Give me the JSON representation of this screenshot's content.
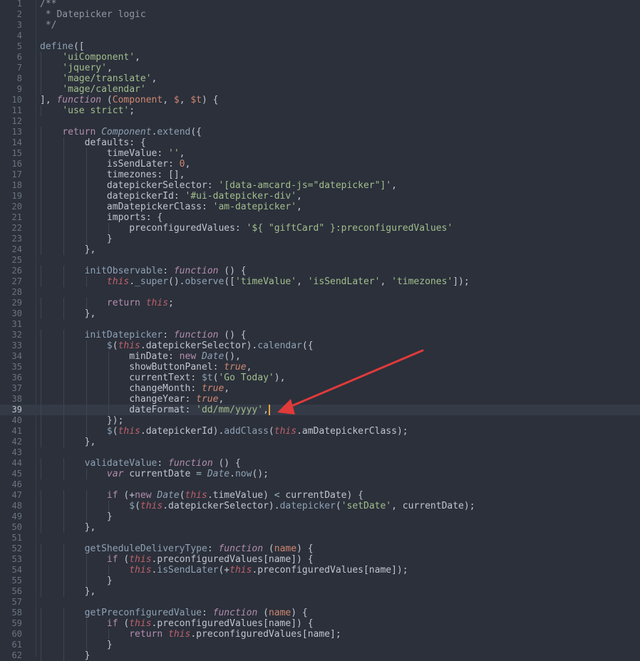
{
  "editor": {
    "current_line": 39,
    "cursor": {
      "line": 39
    },
    "lines": [
      [
        [
          "/**",
          "comment"
        ]
      ],
      [
        [
          " * Datepicker logic",
          "comment"
        ]
      ],
      [
        [
          " */",
          "comment"
        ]
      ],
      [],
      [
        [
          "define",
          "func"
        ],
        [
          "([",
          "punct"
        ]
      ],
      [
        [
          "    ",
          "plain"
        ],
        [
          "'uiComponent'",
          "string"
        ],
        [
          ",",
          "punct"
        ]
      ],
      [
        [
          "    ",
          "plain"
        ],
        [
          "'jquery'",
          "string"
        ],
        [
          ",",
          "punct"
        ]
      ],
      [
        [
          "    ",
          "plain"
        ],
        [
          "'mage/translate'",
          "string"
        ],
        [
          ",",
          "punct"
        ]
      ],
      [
        [
          "    ",
          "plain"
        ],
        [
          "'mage/calendar'",
          "string"
        ]
      ],
      [
        [
          "], ",
          "punct"
        ],
        [
          "function",
          "italic"
        ],
        [
          " (",
          "punct"
        ],
        [
          "Component",
          "param"
        ],
        [
          ", ",
          "punct"
        ],
        [
          "$",
          "param"
        ],
        [
          ", ",
          "punct"
        ],
        [
          "$t",
          "param"
        ],
        [
          ") {",
          "punct"
        ]
      ],
      [
        [
          "    ",
          "plain"
        ],
        [
          "'use strict'",
          "string"
        ],
        [
          ";",
          "punct"
        ]
      ],
      [],
      [
        [
          "    ",
          "plain"
        ],
        [
          "return ",
          "keyword"
        ],
        [
          "Component",
          "classname"
        ],
        [
          ".",
          "punct"
        ],
        [
          "extend",
          "func"
        ],
        [
          "({",
          "punct"
        ]
      ],
      [
        [
          "        defaults: {",
          "plain"
        ]
      ],
      [
        [
          "            timeValue: ",
          "plain"
        ],
        [
          "''",
          "string"
        ],
        [
          ",",
          "punct"
        ]
      ],
      [
        [
          "            isSendLater: ",
          "plain"
        ],
        [
          "0",
          "number"
        ],
        [
          ",",
          "punct"
        ]
      ],
      [
        [
          "            timezones: [],",
          "plain"
        ]
      ],
      [
        [
          "            datepickerSelector: ",
          "plain"
        ],
        [
          "'[data-amcard-js=\"datepicker\"]'",
          "string"
        ],
        [
          ",",
          "punct"
        ]
      ],
      [
        [
          "            datepickerId: ",
          "plain"
        ],
        [
          "'#ui-datepicker-div'",
          "string"
        ],
        [
          ",",
          "punct"
        ]
      ],
      [
        [
          "            amDatepickerClass: ",
          "plain"
        ],
        [
          "'am-datepicker'",
          "string"
        ],
        [
          ",",
          "punct"
        ]
      ],
      [
        [
          "            imports: {",
          "plain"
        ]
      ],
      [
        [
          "                preconfiguredValues: ",
          "plain"
        ],
        [
          "'${ \"giftCard\" }:preconfiguredValues'",
          "string"
        ]
      ],
      [
        [
          "            }",
          "plain"
        ]
      ],
      [
        [
          "        },",
          "plain"
        ]
      ],
      [],
      [
        [
          "        ",
          "plain"
        ],
        [
          "initObservable",
          "func"
        ],
        [
          ": ",
          "punct"
        ],
        [
          "function",
          "italic"
        ],
        [
          " () {",
          "punct"
        ]
      ],
      [
        [
          "            ",
          "plain"
        ],
        [
          "this",
          "this"
        ],
        [
          ".",
          "punct"
        ],
        [
          "_super",
          "func"
        ],
        [
          "().",
          "punct"
        ],
        [
          "observe",
          "func"
        ],
        [
          "([",
          "punct"
        ],
        [
          "'timeValue'",
          "string"
        ],
        [
          ", ",
          "punct"
        ],
        [
          "'isSendLater'",
          "string"
        ],
        [
          ", ",
          "punct"
        ],
        [
          "'timezones'",
          "string"
        ],
        [
          "]);",
          "punct"
        ]
      ],
      [],
      [
        [
          "            ",
          "plain"
        ],
        [
          "return ",
          "keyword"
        ],
        [
          "this",
          "this"
        ],
        [
          ";",
          "punct"
        ]
      ],
      [
        [
          "        },",
          "plain"
        ]
      ],
      [],
      [
        [
          "        ",
          "plain"
        ],
        [
          "initDatepicker",
          "func"
        ],
        [
          ": ",
          "punct"
        ],
        [
          "function",
          "italic"
        ],
        [
          " () {",
          "punct"
        ]
      ],
      [
        [
          "            ",
          "plain"
        ],
        [
          "$",
          "func"
        ],
        [
          "(",
          "punct"
        ],
        [
          "this",
          "this"
        ],
        [
          ".datepickerSelector).",
          "plain"
        ],
        [
          "calendar",
          "func"
        ],
        [
          "({",
          "punct"
        ]
      ],
      [
        [
          "                minDate: ",
          "plain"
        ],
        [
          "new ",
          "keyword"
        ],
        [
          "Date",
          "classname"
        ],
        [
          "(),",
          "punct"
        ]
      ],
      [
        [
          "                showButtonPanel: ",
          "plain"
        ],
        [
          "true",
          "bool"
        ],
        [
          ",",
          "punct"
        ]
      ],
      [
        [
          "                currentText: ",
          "plain"
        ],
        [
          "$t",
          "func"
        ],
        [
          "(",
          "punct"
        ],
        [
          "'Go Today'",
          "string"
        ],
        [
          "),",
          "punct"
        ]
      ],
      [
        [
          "                changeMonth: ",
          "plain"
        ],
        [
          "true",
          "bool"
        ],
        [
          ",",
          "punct"
        ]
      ],
      [
        [
          "                changeYear: ",
          "plain"
        ],
        [
          "true",
          "bool"
        ],
        [
          ",",
          "punct"
        ]
      ],
      [
        [
          "                dateFormat: ",
          "plain"
        ],
        [
          "'dd/mm/yyyy'",
          "string"
        ],
        [
          ",",
          "punct"
        ]
      ],
      [
        [
          "            });",
          "plain"
        ]
      ],
      [
        [
          "            ",
          "plain"
        ],
        [
          "$",
          "func"
        ],
        [
          "(",
          "punct"
        ],
        [
          "this",
          "this"
        ],
        [
          ".datepickerId).",
          "plain"
        ],
        [
          "addClass",
          "func"
        ],
        [
          "(",
          "punct"
        ],
        [
          "this",
          "this"
        ],
        [
          ".amDatepickerClass);",
          "plain"
        ]
      ],
      [
        [
          "        },",
          "plain"
        ]
      ],
      [],
      [
        [
          "        ",
          "plain"
        ],
        [
          "validateValue",
          "func"
        ],
        [
          ": ",
          "punct"
        ],
        [
          "function",
          "italic"
        ],
        [
          " () {",
          "punct"
        ]
      ],
      [
        [
          "            ",
          "plain"
        ],
        [
          "var ",
          "italic"
        ],
        [
          "currentDate ",
          "plain"
        ],
        [
          "=",
          "op"
        ],
        [
          " ",
          "plain"
        ],
        [
          "Date",
          "classname"
        ],
        [
          ".",
          "punct"
        ],
        [
          "now",
          "func"
        ],
        [
          "();",
          "punct"
        ]
      ],
      [],
      [
        [
          "            ",
          "plain"
        ],
        [
          "if ",
          "keyword"
        ],
        [
          "(+",
          "punct"
        ],
        [
          "new ",
          "keyword"
        ],
        [
          "Date",
          "classname"
        ],
        [
          "(",
          "punct"
        ],
        [
          "this",
          "this"
        ],
        [
          ".timeValue) ",
          "plain"
        ],
        [
          "<",
          "op"
        ],
        [
          " currentDate) {",
          "plain"
        ]
      ],
      [
        [
          "                ",
          "plain"
        ],
        [
          "$",
          "func"
        ],
        [
          "(",
          "punct"
        ],
        [
          "this",
          "this"
        ],
        [
          ".datepickerSelector).",
          "plain"
        ],
        [
          "datepicker",
          "func"
        ],
        [
          "(",
          "punct"
        ],
        [
          "'setDate'",
          "string"
        ],
        [
          ", currentDate);",
          "plain"
        ]
      ],
      [
        [
          "            }",
          "plain"
        ]
      ],
      [
        [
          "        },",
          "plain"
        ]
      ],
      [],
      [
        [
          "        ",
          "plain"
        ],
        [
          "getSheduleDeliveryType",
          "func"
        ],
        [
          ": ",
          "punct"
        ],
        [
          "function",
          "italic"
        ],
        [
          " (",
          "punct"
        ],
        [
          "name",
          "param"
        ],
        [
          ") {",
          "punct"
        ]
      ],
      [
        [
          "            ",
          "plain"
        ],
        [
          "if ",
          "keyword"
        ],
        [
          "(",
          "punct"
        ],
        [
          "this",
          "this"
        ],
        [
          ".preconfiguredValues[name]) {",
          "plain"
        ]
      ],
      [
        [
          "                ",
          "plain"
        ],
        [
          "this",
          "this"
        ],
        [
          ".",
          "punct"
        ],
        [
          "isSendLater",
          "func"
        ],
        [
          "(+",
          "punct"
        ],
        [
          "this",
          "this"
        ],
        [
          ".preconfiguredValues[name]);",
          "plain"
        ]
      ],
      [
        [
          "            }",
          "plain"
        ]
      ],
      [
        [
          "        },",
          "plain"
        ]
      ],
      [],
      [
        [
          "        ",
          "plain"
        ],
        [
          "getPreconfiguredValue",
          "func"
        ],
        [
          ": ",
          "punct"
        ],
        [
          "function",
          "italic"
        ],
        [
          " (",
          "punct"
        ],
        [
          "name",
          "param"
        ],
        [
          ") {",
          "punct"
        ]
      ],
      [
        [
          "            ",
          "plain"
        ],
        [
          "if ",
          "keyword"
        ],
        [
          "(",
          "punct"
        ],
        [
          "this",
          "this"
        ],
        [
          ".preconfiguredValues[name]) {",
          "plain"
        ]
      ],
      [
        [
          "                ",
          "plain"
        ],
        [
          "return ",
          "keyword"
        ],
        [
          "this",
          "this"
        ],
        [
          ".preconfiguredValues[name];",
          "plain"
        ]
      ],
      [
        [
          "            }",
          "plain"
        ]
      ],
      [
        [
          "        }",
          "plain"
        ]
      ]
    ]
  },
  "colors": {
    "background": "#2b303b",
    "annotation_arrow": "#e03a3a",
    "cursor": "#f0a23a"
  }
}
